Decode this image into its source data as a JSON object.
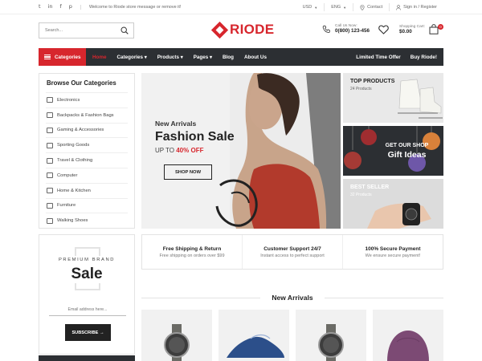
{
  "topbar": {
    "social_icons": [
      "twitter-icon",
      "linkedin-icon",
      "facebook-icon",
      "pinterest-icon"
    ],
    "social_glyphs": [
      "t",
      "in",
      "f",
      "p"
    ],
    "welcome": "Welcome to Riode store message or remove it!",
    "currency": "USD",
    "language": "ENG",
    "contact": "Contact",
    "signin": "Sign in / Register"
  },
  "header": {
    "search_placeholder": "Search...",
    "logo_text": "RIODE",
    "call_label": "Call Us Now:",
    "call_number": "0(800) 123-456",
    "cart_label": "Shopping Cart:",
    "cart_amount": "$0.00",
    "cart_count": "0"
  },
  "nav": {
    "categories": "Categories",
    "items": [
      "Home",
      "Categories",
      "Products",
      "Pages",
      "Blog",
      "About Us"
    ],
    "dropdown_items": [
      false,
      true,
      true,
      true,
      false,
      false
    ],
    "right": [
      "Limited Time Offer",
      "Buy Riode!"
    ]
  },
  "sidebar": {
    "title": "Browse Our Categories",
    "items": [
      "Electronics",
      "Backpacks & Fashion Bags",
      "Gaming & Accessories",
      "Sporting Goods",
      "Travel & Clothing",
      "Computer",
      "Home & Kitchen",
      "Furniture",
      "Walking Shoes"
    ]
  },
  "hero": {
    "subtitle": "New Arrivals",
    "title": "Fashion Sale",
    "up_to": "UP TO ",
    "discount": "40% OFF",
    "button": "SHOP NOW"
  },
  "banners": {
    "top_title": "TOP PRODUCTS",
    "top_sub": "24 Products",
    "gift_line1": "GET OUR SHOP",
    "gift_line2": "Gift Ideas",
    "best_title": "BEST SELLER",
    "best_sub": "32 Products"
  },
  "promo": {
    "brand": "PREMIUM BRAND",
    "sale": "Sale",
    "email_placeholder": "Email address here...",
    "subscribe": "SUBSCRIBE"
  },
  "features": [
    {
      "title": "Free Shipping & Return",
      "sub": "Free shipping on orders over $99"
    },
    {
      "title": "Customer Support 24/7",
      "sub": "Instant access to perfect support"
    },
    {
      "title": "100% Secure Payment",
      "sub": "We ensure secure payment!"
    }
  ],
  "new_arrivals": {
    "title": "New Arrivals"
  },
  "colors": {
    "accent": "#d7262d",
    "nav_bg": "#2c2f33"
  }
}
